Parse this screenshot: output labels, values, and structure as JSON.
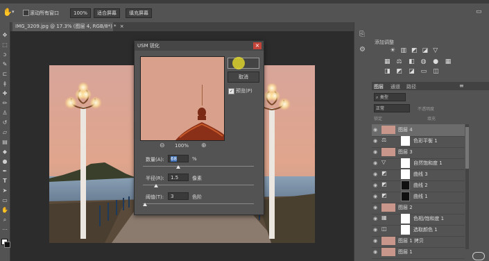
{
  "options_bar": {
    "scroll_all_windows": "滚动所有窗口",
    "zoom_100": "100%",
    "fit_screen": "适合屏幕",
    "fill_screen": "填充屏幕"
  },
  "document_tab": {
    "title": "IMG_3209.jpg @ 17.3% (图层 4, RGB/8*) *"
  },
  "dialog": {
    "title": "USM 锐化",
    "ok_label": "",
    "cancel_label": "取消",
    "preview_label": "预览(P)",
    "preview_checked": true,
    "zoom_level": "100%",
    "amount_label": "数量(A):",
    "amount_value": "68",
    "amount_unit": "%",
    "radius_label": "半径(R):",
    "radius_value": "1.5",
    "radius_unit": "像素",
    "threshold_label": "阈值(T):",
    "threshold_value": "3",
    "threshold_unit": "色阶",
    "amount_slider_fraction": 0.32,
    "radius_slider_fraction": 0.12,
    "threshold_slider_fraction": 0.02
  },
  "adjustments": {
    "title": "添加调整"
  },
  "layers_panel": {
    "tabs": [
      "图层",
      "通道",
      "路径"
    ],
    "kind_filter": "类型",
    "blend_mode": "正常",
    "opacity_label": "不透明度",
    "lock_label": "锁定",
    "fill_label": "填充",
    "layers": [
      {
        "name": "图层 4",
        "kind": "pixel"
      },
      {
        "name": "色彩平衡 1",
        "kind": "adjustment"
      },
      {
        "name": "图层 3",
        "kind": "pixel"
      },
      {
        "name": "自然饱和度 1",
        "kind": "adjustment"
      },
      {
        "name": "曲线 3",
        "kind": "adjustment"
      },
      {
        "name": "曲线 2",
        "kind": "adjustment"
      },
      {
        "name": "曲线 1",
        "kind": "adjustment"
      },
      {
        "name": "图层 2",
        "kind": "pixel"
      },
      {
        "name": "色相/饱和度 1",
        "kind": "adjustment"
      },
      {
        "name": "选取颜色 1",
        "kind": "adjustment"
      },
      {
        "name": "图层 1 拷贝",
        "kind": "pixel"
      },
      {
        "name": "图层 1",
        "kind": "pixel"
      }
    ]
  }
}
